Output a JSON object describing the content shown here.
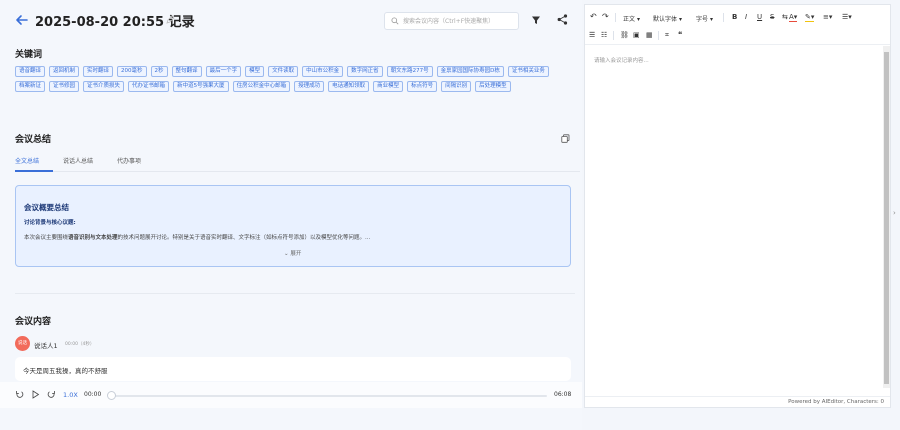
{
  "header": {
    "title": "2025-08-20 20:55 记录",
    "search_placeholder": "搜索会议内容（Ctrl+F快速聚焦）"
  },
  "keywords": {
    "title": "关键词",
    "tags": [
      "语音翻译",
      "返回机制",
      "实时翻译",
      "200毫秒",
      "2秒",
      "整句翻译",
      "最后一个字",
      "模型",
      "文件读取",
      "中山市公积金",
      "数字网正省",
      "朝文东路277号",
      "金禀家园国际协寿园D栋",
      "证书相关业务",
      "档案新证",
      "证书修园",
      "证书介质损失",
      "代办证书邮箱",
      "新中道5号强果大厦",
      "住房公积金中心邮箱",
      "授理成功",
      "电话通知领取",
      "商业模型",
      "标点符号",
      "间隔识别",
      "后处理模型"
    ]
  },
  "summary": {
    "title": "会议总结",
    "tabs": [
      "全文总结",
      "说话人总结",
      "代办事项"
    ],
    "box_title": "会议概要总结",
    "box_sub": "讨论背景与核心议题:",
    "box_text_1": "本次会议主要围绕",
    "box_text_bold": "语音识别与文本处理",
    "box_text_2": "的技术问题展开讨论。特别是关于语音实时翻译、文字标注（如标点符号添加）以及模型优化等问题。...",
    "expand_label": "展开"
  },
  "content": {
    "title": "会议内容",
    "speaker": {
      "avatar_text": "说话",
      "name": "说话人1",
      "meta": "00:00（4秒）",
      "text": "今天是周五我操，真的不舒服"
    }
  },
  "player": {
    "speed": "1.0X",
    "current": "00:00",
    "total": "06:08",
    "progress": 0
  },
  "editor": {
    "toolbar": {
      "paragraph": "正文",
      "font": "默认字体",
      "size": "字号"
    },
    "placeholder": "请输入会议记录内容...",
    "status": "Powered by AIEditor, Characters: 0"
  },
  "colors": {
    "accent": "#3a6fd8",
    "avatar": "#f26b5b"
  }
}
